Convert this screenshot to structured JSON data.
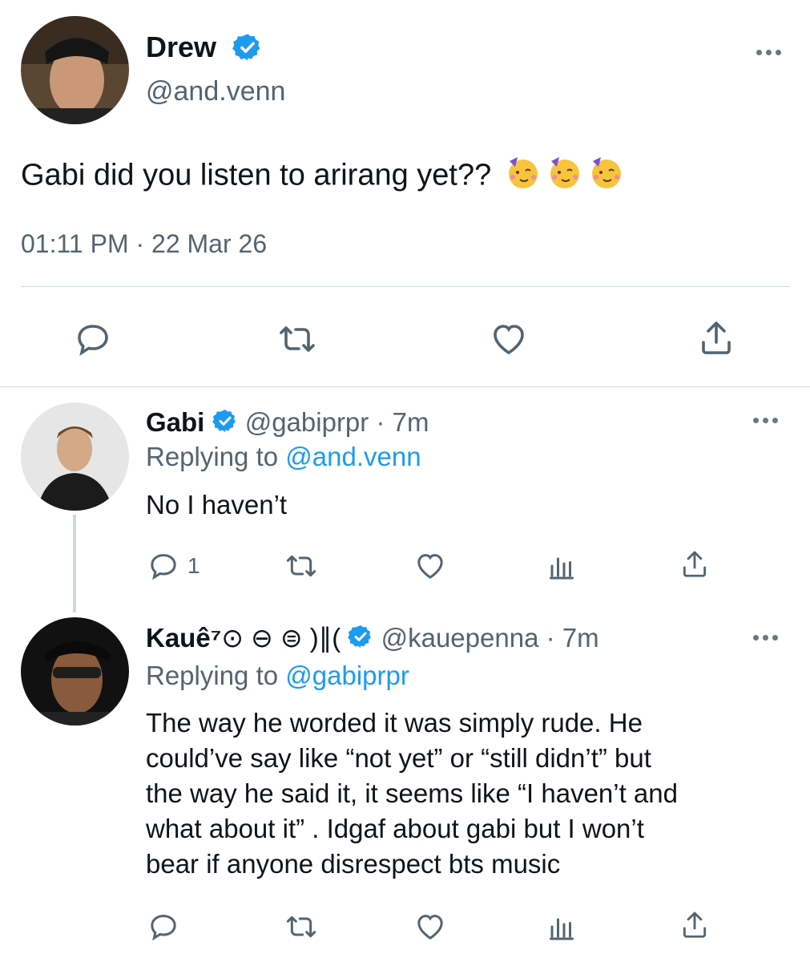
{
  "main_tweet": {
    "author_name": "Drew",
    "author_handle": "@and.venn",
    "text": "Gabi did you listen to arirang yet??",
    "emojis": [
      "partying-face-emoji",
      "partying-face-emoji",
      "partying-face-emoji"
    ],
    "timestamp": "01:11 PM · 22 Mar 26",
    "actions": [
      "reply-icon",
      "retweet-icon",
      "like-icon",
      "share-icon"
    ]
  },
  "replies": [
    {
      "author_name": "Gabi",
      "author_handle": "@gabiprpr",
      "separator": "·",
      "time": "7m",
      "replying_prefix": "Replying to",
      "replying_to": "@and.venn",
      "text": "No I haven’t",
      "reply_count": "1"
    },
    {
      "author_name": "Kauê⁷",
      "name_symbols": "⊙ ⊖ ⊜ )∥(",
      "author_handle": "@kauepenna",
      "separator": "·",
      "time": "7m",
      "replying_prefix": "Replying to",
      "replying_to": "@gabiprpr",
      "text_lines": [
        "The way he worded it was simply rude. He",
        "could’ve say like “not yet” or “still didn’t” but",
        "the way he said it, it seems like “I haven’t and",
        "what about it” . Idgaf about gabi but I won’t",
        "bear if anyone disrespect bts music"
      ]
    }
  ],
  "colors": {
    "verified": "#1d9bf0",
    "link": "#1d9bf0",
    "secondary_text": "#536471",
    "divider": "#cfd9de"
  }
}
